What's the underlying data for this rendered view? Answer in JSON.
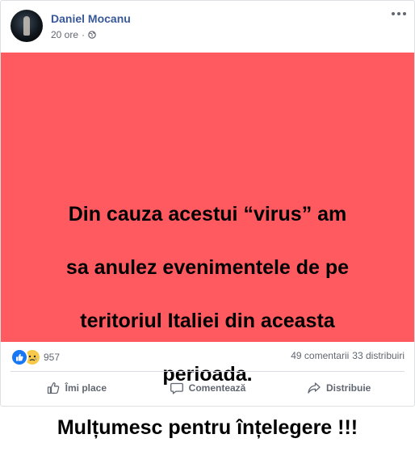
{
  "post": {
    "author": "Daniel Mocanu",
    "time": "20 ore",
    "separator": "·",
    "privacy_icon": "globe-icon",
    "options_icon": "more-options-icon"
  },
  "panel": {
    "background": "#ff5a5f",
    "lines": [
      "Din cauza acestui “virus” am",
      "sa anulez evenimentele de pe",
      "teritoriul Italiei din aceasta",
      "perioada.",
      "Mulțumesc pentru înțelegere !!!"
    ]
  },
  "stats": {
    "reaction_icons": [
      "like-reaction-icon",
      "sad-reaction-icon"
    ],
    "reaction_count": "957",
    "comments": "49 comentarii",
    "shares": "33 distribuiri"
  },
  "actions": {
    "like": "Îmi place",
    "comment": "Comentează",
    "share": "Distribuie"
  },
  "colors": {
    "link": "#385898",
    "muted": "#606770",
    "like_blue": "#1877f2"
  }
}
